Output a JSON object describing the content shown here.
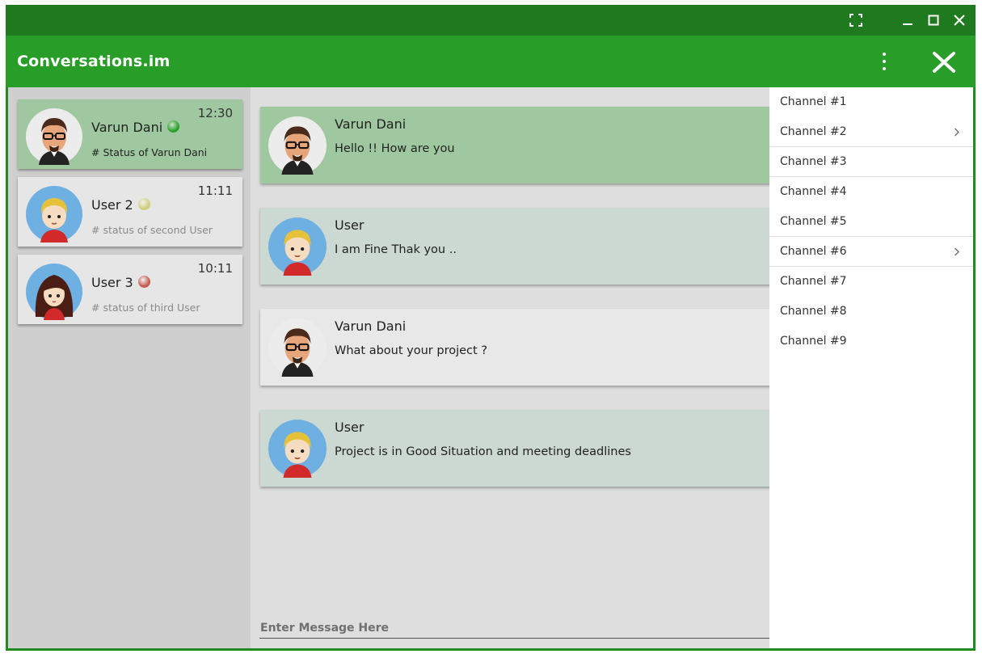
{
  "app": {
    "title": "Conversations.im"
  },
  "titlebar": {
    "icons": [
      "fullscreen-icon",
      "minimize-icon",
      "maximize-icon",
      "close-icon"
    ]
  },
  "appbar": {
    "icons": [
      "more-vert-icon",
      "close-icon"
    ]
  },
  "contacts": [
    {
      "name": "Varun Dani",
      "time": "12:30",
      "status": "# Status of Varun Dani",
      "presence_color": "#2aa02a",
      "bg": "#a0c8a0",
      "status_color": "#222222"
    },
    {
      "name": "User 2",
      "time": "11:11",
      "status": "# status of second User",
      "presence_color": "#cfcf7a",
      "bg": "#e6e6e6",
      "status_color": "#8a8a8a"
    },
    {
      "name": "User 3",
      "time": "10:11",
      "status": "# status of third User",
      "presence_color": "#c85a50",
      "bg": "#e6e6e6",
      "status_color": "#8a8a8a"
    }
  ],
  "messages": [
    {
      "sender": "Varun Dani",
      "text": "Hello !! How are you",
      "bg": "#a0c8a0"
    },
    {
      "sender": "User",
      "text": "I am Fine Thak you ..",
      "bg": "#ccd9d2"
    },
    {
      "sender": "Varun Dani",
      "text": "What about your project ?",
      "bg": "#e8e8e8"
    },
    {
      "sender": "User",
      "text": "Project is in Good Situation and meeting deadlines",
      "bg": "#ccd9d2"
    }
  ],
  "composer": {
    "placeholder": "Enter Message Here"
  },
  "menu": {
    "items": [
      {
        "label": "Channel #1",
        "submenu": false
      },
      {
        "label": "Channel #2",
        "submenu": true
      },
      {
        "label": "Channel #3",
        "submenu": false
      },
      {
        "label": "Channel #4",
        "submenu": false
      },
      {
        "label": "Channel #5",
        "submenu": false
      },
      {
        "label": "Channel #6",
        "submenu": true
      },
      {
        "label": "Channel #7",
        "submenu": false
      },
      {
        "label": "Channel #8",
        "submenu": false
      },
      {
        "label": "Channel #9",
        "submenu": false
      }
    ]
  },
  "colors": {
    "titlebar": "#1f7a1f",
    "appbar": "#289d28",
    "window_border": "#228b22",
    "sidebar_bg": "#cfcfcf",
    "chat_bg": "#dedede"
  }
}
